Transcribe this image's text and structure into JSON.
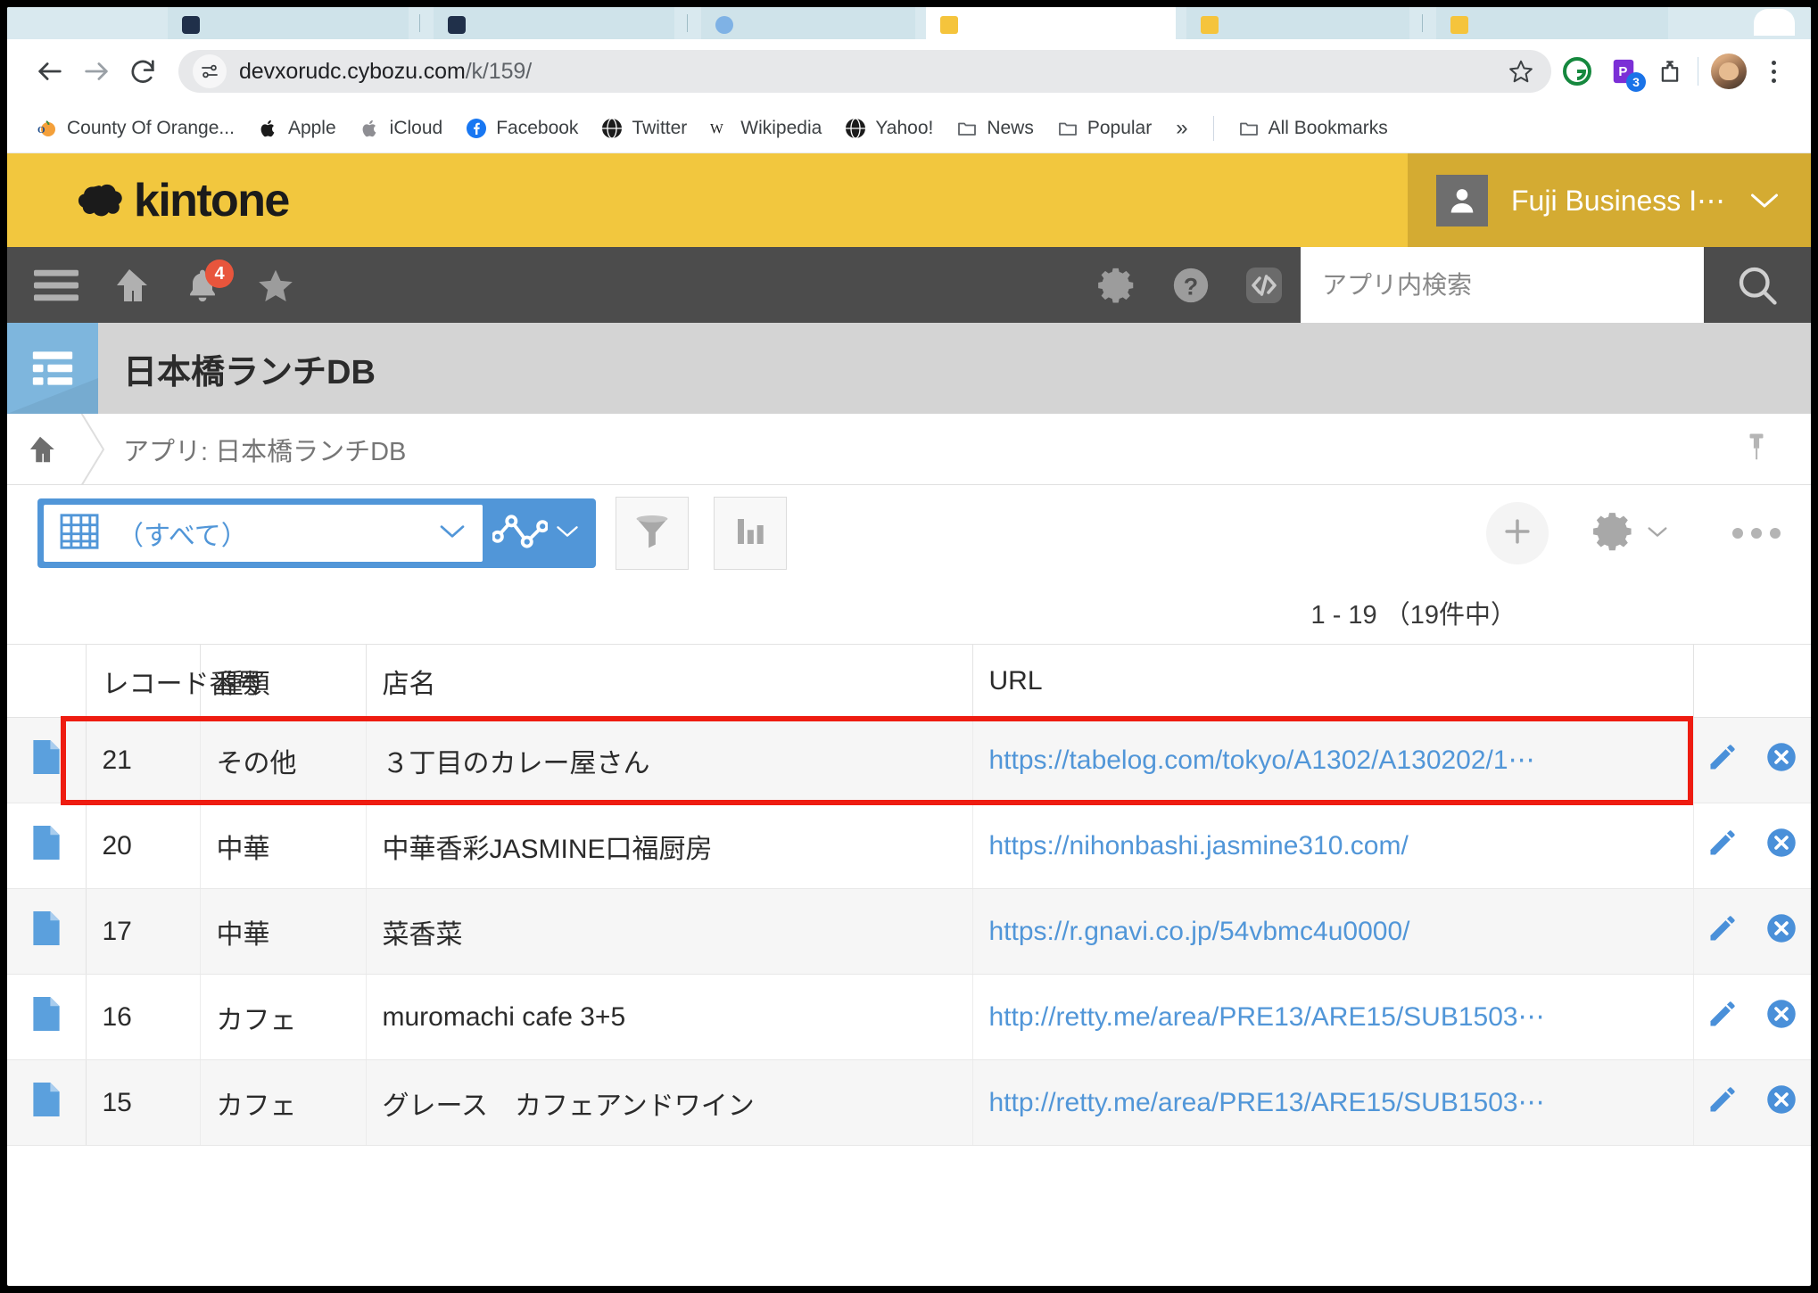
{
  "browser": {
    "tabs": [
      {
        "title": "",
        "favicon": "dark-favicon",
        "active": false
      },
      {
        "title": "",
        "favicon": "dark-favicon",
        "active": false
      },
      {
        "title": "",
        "favicon": "kintone-favicon",
        "active": true
      },
      {
        "title": "",
        "favicon": "blue-favicon",
        "active": false
      },
      {
        "title": "",
        "favicon": "kintone-favicon",
        "active": false
      },
      {
        "title": "",
        "favicon": "kintone-favicon",
        "active": false
      }
    ],
    "back_icon": "back-arrow-icon",
    "forward_icon": "forward-arrow-icon",
    "reload_icon": "reload-icon",
    "site_info_icon": "site-settings-icon",
    "url": "devxorudc.cybozu.com",
    "url_path": "/k/159/",
    "bookmark_star_icon": "star-icon",
    "extensions": [
      {
        "name": "grammarly-extension-icon",
        "badge": ""
      },
      {
        "name": "purple-extension-icon",
        "badge": "3"
      },
      {
        "name": "extensions-puzzle-icon",
        "badge": ""
      }
    ],
    "profile_icon": "profile-avatar",
    "menu_icon": "three-dot-menu-icon",
    "bookmarks": [
      {
        "label": "County Of Orange...",
        "icon": "orange-county-icon"
      },
      {
        "label": "Apple",
        "icon": "apple-icon"
      },
      {
        "label": "iCloud",
        "icon": "icloud-icon"
      },
      {
        "label": "Facebook",
        "icon": "facebook-icon"
      },
      {
        "label": "Twitter",
        "icon": "twitter-icon"
      },
      {
        "label": "Wikipedia",
        "icon": "wikipedia-icon"
      },
      {
        "label": "Yahoo!",
        "icon": "yahoo-icon"
      },
      {
        "label": "News",
        "icon": "folder-icon"
      },
      {
        "label": "Popular",
        "icon": "folder-icon"
      }
    ],
    "bookmarks_overflow": "»",
    "all_bookmarks_label": "All Bookmarks",
    "all_bookmarks_icon": "folder-icon"
  },
  "kintone": {
    "brand_name": "kintone",
    "brand_bg": "#f2c73e",
    "user": {
      "name": "Fuji Business I⋯",
      "avatar_icon": "user-avatar-icon",
      "chevron_icon": "chevron-down-icon"
    },
    "nav": {
      "menu_icon": "hamburger-menu-icon",
      "home_icon": "home-icon",
      "bell_icon": "notification-bell-icon",
      "bell_badge": "4",
      "star_icon": "favorites-star-icon",
      "gear_icon": "gear-icon",
      "help_icon": "help-question-icon",
      "code_icon": "code-brackets-icon"
    },
    "search": {
      "placeholder": "アプリ内検索",
      "value": "",
      "button_icon": "search-magnifier-icon"
    }
  },
  "app": {
    "icon": "app-list-icon",
    "title": "日本橋ランチDB",
    "breadcrumb": {
      "home_icon": "home-icon",
      "text": "アプリ: 日本橋ランチDB"
    },
    "pin_icon": "pin-icon"
  },
  "toolbar": {
    "view_icon": "table-view-icon",
    "view_label": "（すべて）",
    "view_chevron_icon": "chevron-down-icon",
    "graph_icon": "line-graph-icon",
    "graph_chevron_icon": "chevron-down-icon",
    "filter_icon": "filter-funnel-icon",
    "chart_icon": "bar-chart-icon",
    "add_icon": "plus-icon",
    "settings_icon": "gear-icon",
    "settings_chevron_icon": "chevron-down-icon",
    "more_icon": "ellipsis-icon"
  },
  "pagination": {
    "text": "1 - 19 （19件中）"
  },
  "table": {
    "columns": [
      {
        "key": "icon",
        "label": ""
      },
      {
        "key": "record_no",
        "label": "レコード番号"
      },
      {
        "key": "type",
        "label": "種類"
      },
      {
        "key": "store",
        "label": "店名"
      },
      {
        "key": "url",
        "label": "URL"
      },
      {
        "key": "actions",
        "label": ""
      }
    ],
    "rows": [
      {
        "icon": "record-document-icon",
        "record_no": "21",
        "type": "その他",
        "store": "３丁目のカレー屋さん",
        "url": "https://tabelog.com/tokyo/A1302/A130202/1⋯",
        "edit_icon": "edit-pencil-icon",
        "delete_icon": "delete-x-icon",
        "highlighted": true
      },
      {
        "icon": "record-document-icon",
        "record_no": "20",
        "type": "中華",
        "store": "中華香彩JASMINE口福厨房",
        "url": "https://nihonbashi.jasmine310.com/",
        "edit_icon": "edit-pencil-icon",
        "delete_icon": "delete-x-icon",
        "highlighted": false
      },
      {
        "icon": "record-document-icon",
        "record_no": "17",
        "type": "中華",
        "store": "菜香菜",
        "url": "https://r.gnavi.co.jp/54vbmc4u0000/",
        "edit_icon": "edit-pencil-icon",
        "delete_icon": "delete-x-icon",
        "highlighted": false
      },
      {
        "icon": "record-document-icon",
        "record_no": "16",
        "type": "カフェ",
        "store": "muromachi cafe 3+5",
        "url": "http://retty.me/area/PRE13/ARE15/SUB1503⋯",
        "edit_icon": "edit-pencil-icon",
        "delete_icon": "delete-x-icon",
        "highlighted": false
      },
      {
        "icon": "record-document-icon",
        "record_no": "15",
        "type": "カフェ",
        "store": "グレース　カフェアンドワイン",
        "url": "http://retty.me/area/PRE13/ARE15/SUB1503⋯",
        "edit_icon": "edit-pencil-icon",
        "delete_icon": "delete-x-icon",
        "highlighted": false
      }
    ]
  },
  "annotation": {
    "highlight_color": "#ee1c11",
    "highlight_row_index": 0
  }
}
